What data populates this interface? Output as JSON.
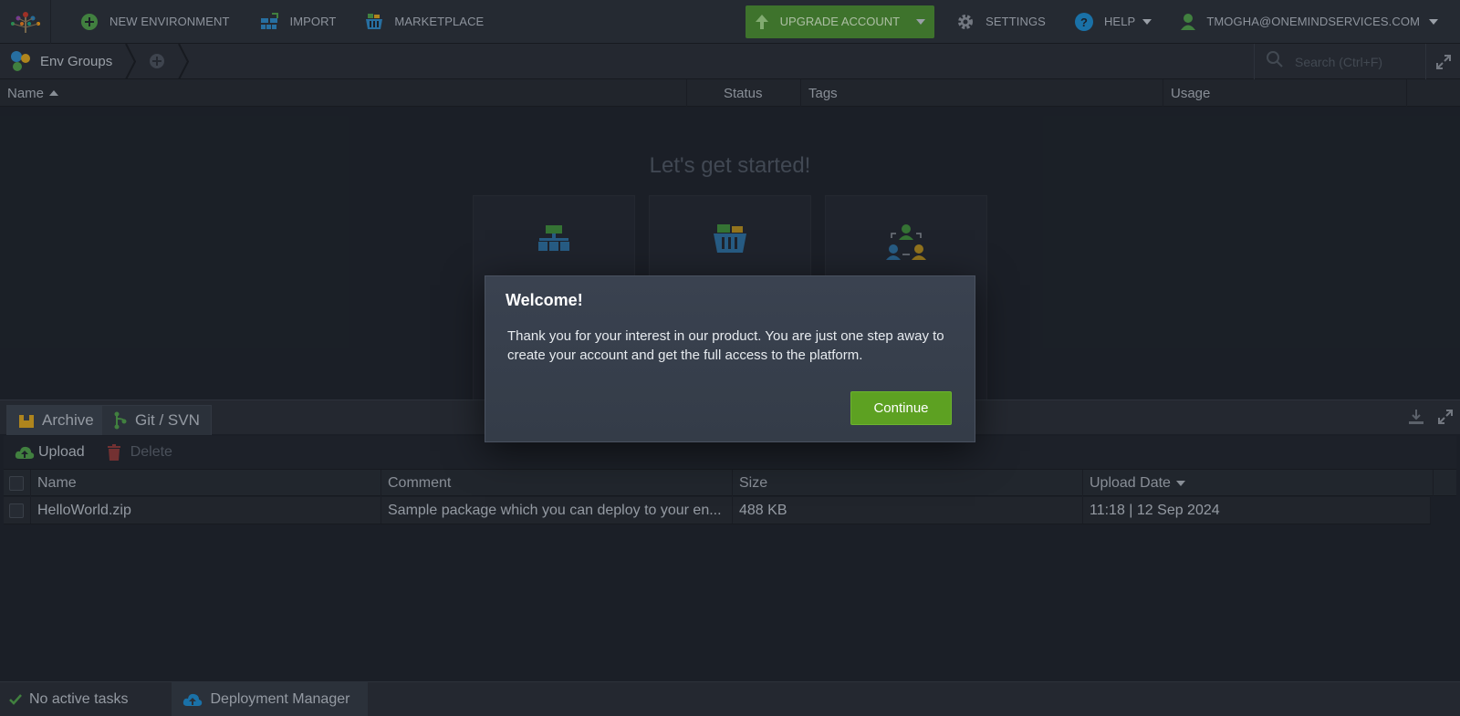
{
  "topbar": {
    "new_environment": "NEW ENVIRONMENT",
    "import": "IMPORT",
    "marketplace": "MARKETPLACE",
    "upgrade_account": "UPGRADE ACCOUNT",
    "settings": "SETTINGS",
    "help": "HELP",
    "user": "TMOGHA@ONEMINDSERVICES.COM"
  },
  "breadcrumb": {
    "env_groups": "Env Groups"
  },
  "search": {
    "placeholder": "Search (Ctrl+F)"
  },
  "env_table": {
    "columns": [
      "Name",
      "Status",
      "Tags",
      "Usage"
    ]
  },
  "get_started": {
    "title": "Let's get started!"
  },
  "deployment_manager": {
    "tabs": [
      "Archive",
      "Git / SVN"
    ],
    "upload": "Upload",
    "delete": "Delete",
    "columns": [
      "Name",
      "Comment",
      "Size",
      "Upload Date"
    ],
    "rows": [
      {
        "name": "HelloWorld.zip",
        "comment": "Sample package which you can deploy to your en...",
        "size": "488 KB",
        "upload_date": "11:18 | 12 Sep 2024"
      }
    ]
  },
  "statusbar": {
    "tasks": "No active tasks",
    "deployment_manager": "Deployment Manager"
  },
  "modal": {
    "title": "Welcome!",
    "body": "Thank you for your interest in our product. You are just one step away to create your account and get the full access to the platform.",
    "continue": "Continue"
  },
  "colors": {
    "accent_green": "#5da122",
    "upgrade_green": "#4a8a33",
    "help_blue": "#1e88c9",
    "background": "#1f242c"
  }
}
